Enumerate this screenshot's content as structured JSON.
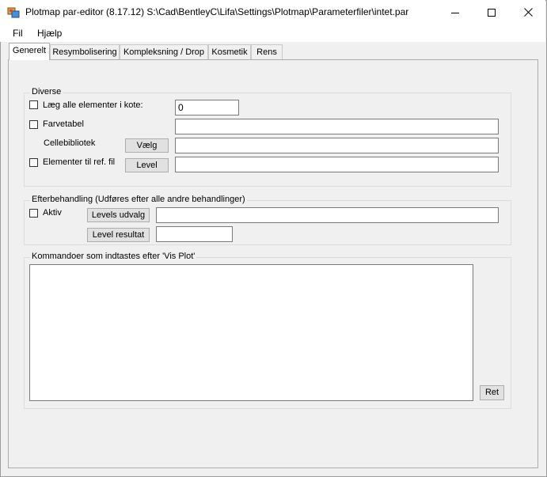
{
  "window": {
    "title": "Plotmap par-editor (8.17.12) S:\\Cad\\BentleyC\\Lifa\\Settings\\Plotmap\\Parameterfiler\\intet.par",
    "icon": "app-icon",
    "controls": {
      "minimize": "–",
      "maximize": "☐",
      "close": "✕"
    }
  },
  "menu": {
    "items": [
      {
        "label": "Fil"
      },
      {
        "label": "Hjælp"
      }
    ]
  },
  "tabs": [
    {
      "label": "Generelt",
      "active": true
    },
    {
      "label": "Resymbolisering"
    },
    {
      "label": "Kompleksning / Drop"
    },
    {
      "label": "Kosmetik"
    },
    {
      "label": "Rens"
    }
  ],
  "diverse": {
    "title": "Diverse",
    "kote_label": "Læg alle elementer i kote:",
    "kote_value": "0",
    "farvetabel_label": "Farvetabel",
    "farvetabel_value": "",
    "cellebibliotek_label": "Cellebibliotek",
    "vaelg_button": "Vælg",
    "cellebibliotek_value": "",
    "ref_label": "Elementer til ref. fil",
    "level_button": "Level",
    "ref_value": ""
  },
  "efterbehandling": {
    "title": "Efterbehandling (Udføres efter alle andre behandlinger)",
    "aktiv_label": "Aktiv",
    "levels_udvalg_button": "Levels udvalg",
    "levels_udvalg_value": "",
    "level_resultat_button": "Level resultat",
    "level_resultat_value": ""
  },
  "kommandoer": {
    "title": "Kommandoer som indtastes efter 'Vis Plot'",
    "value": "",
    "ret_button": "Ret"
  }
}
